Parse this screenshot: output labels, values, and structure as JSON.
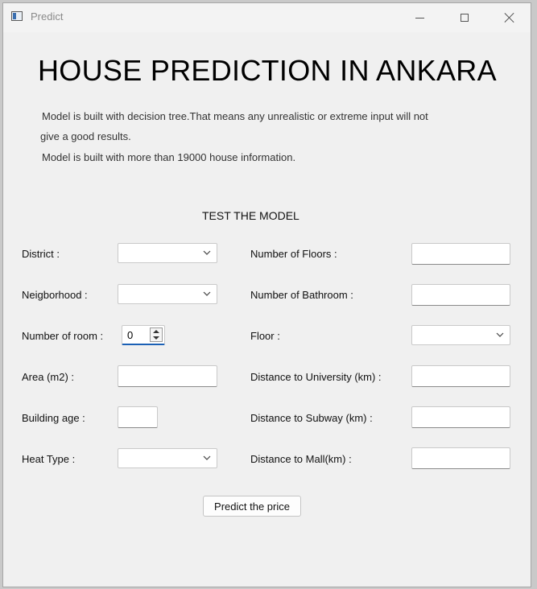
{
  "window": {
    "title": "Predict"
  },
  "heading": "HOUSE PREDICTION IN ANKARA",
  "info": {
    "line1": "Model is built with decision tree.That means any unrealistic or extreme input will not",
    "line2": "give a good results.",
    "line3": "Model is built with more than 19000 house information."
  },
  "section_title": "TEST THE MODEL",
  "form": {
    "left": {
      "district_label": "District :",
      "district_value": "",
      "neighborhood_label": "Neigborhood :",
      "neighborhood_value": "",
      "rooms_label": "Number of room :",
      "rooms_value": "0",
      "area_label": "Area (m2) :",
      "area_value": "",
      "building_age_label": "Building age :",
      "building_age_value": "",
      "heat_type_label": "Heat Type :",
      "heat_type_value": ""
    },
    "right": {
      "floors_label": "Number of Floors :",
      "floors_value": "",
      "bathroom_label": "Number of Bathroom :",
      "bathroom_value": "",
      "floor_label": "Floor :",
      "floor_value": "",
      "dist_university_label": "Distance to University (km) :",
      "dist_university_value": "",
      "dist_subway_label": "Distance to Subway (km) :",
      "dist_subway_value": "",
      "dist_mall_label": "Distance to Mall(km) :",
      "dist_mall_value": ""
    },
    "submit_label": "Predict the price"
  },
  "colors": {
    "background": "#f0f0f0",
    "focus_accent": "#1b60b5"
  },
  "icons": {
    "app": "window-icon",
    "dropdown": "chevron-down-icon",
    "minimize": "minimize-icon",
    "maximize": "maximize-icon",
    "close": "close-icon"
  }
}
